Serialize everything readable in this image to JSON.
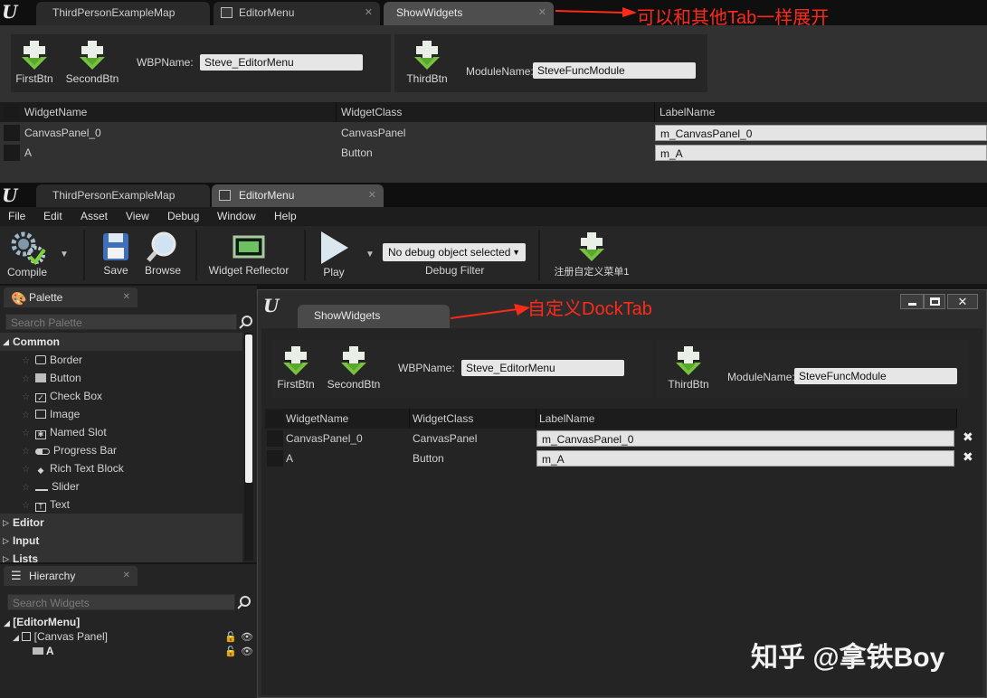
{
  "top_window": {
    "tabs": [
      "ThirdPersonExampleMap",
      "EditorMenu",
      "ShowWidgets"
    ],
    "buttons": [
      "FirstBtn",
      "SecondBtn",
      "ThirdBtn"
    ],
    "wbp_label": "WBPName:",
    "wbp_value": "Steve_EditorMenu",
    "module_label": "ModuleName:",
    "module_value": "SteveFuncModule",
    "columns": [
      "WidgetName",
      "WidgetClass",
      "LabelName"
    ],
    "rows": [
      {
        "name": "CanvasPanel_0",
        "cls": "CanvasPanel",
        "label": "m_CanvasPanel_0"
      },
      {
        "name": "A",
        "cls": "Button",
        "label": "m_A"
      }
    ]
  },
  "annotation_top": "可以和其他Tab一样展开",
  "annotation_dock": "自定义DockTab",
  "main_window": {
    "tabs": [
      "ThirdPersonExampleMap",
      "EditorMenu"
    ],
    "menu": [
      "File",
      "Edit",
      "Asset",
      "View",
      "Debug",
      "Window",
      "Help"
    ],
    "toolbar": {
      "compile": "Compile",
      "save": "Save",
      "browse": "Browse",
      "widget_reflector": "Widget Reflector",
      "play": "Play",
      "debug_select": "No debug object selected",
      "debug_filter": "Debug Filter",
      "custom_menu": "注册自定义菜单1"
    },
    "palette": {
      "title": "Palette",
      "search_placeholder": "Search Palette",
      "common": "Common",
      "items": [
        "Border",
        "Button",
        "Check Box",
        "Image",
        "Named Slot",
        "Progress Bar",
        "Rich Text Block",
        "Slider",
        "Text"
      ],
      "categories": [
        "Editor",
        "Input",
        "Lists"
      ]
    },
    "hierarchy": {
      "title": "Hierarchy",
      "search_placeholder": "Search Widgets",
      "root": "[EditorMenu]",
      "canvas": "[Canvas Panel]",
      "child": "A"
    }
  },
  "dock_window": {
    "tab": "ShowWidgets",
    "buttons": [
      "FirstBtn",
      "SecondBtn",
      "ThirdBtn"
    ],
    "wbp_label": "WBPName:",
    "wbp_value": "Steve_EditorMenu",
    "module_label": "ModuleName:",
    "module_value": "SteveFuncModule",
    "columns": [
      "WidgetName",
      "WidgetClass",
      "LabelName"
    ],
    "rows": [
      {
        "name": "CanvasPanel_0",
        "cls": "CanvasPanel",
        "label": "m_CanvasPanel_0"
      },
      {
        "name": "A",
        "cls": "Button",
        "label": "m_A"
      }
    ]
  },
  "watermark": "知乎 @拿铁Boy",
  "colors": {
    "annotation": "#ff2a1a",
    "background": "#151515",
    "panel": "#262626"
  }
}
